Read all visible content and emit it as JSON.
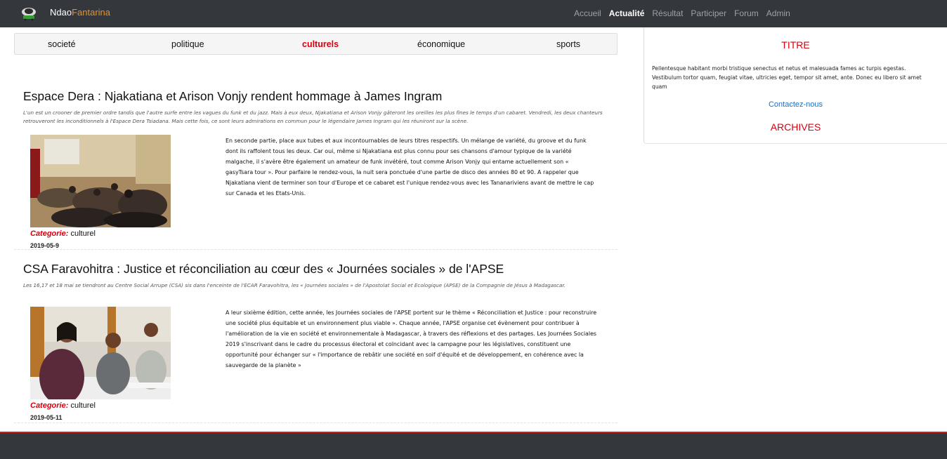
{
  "header": {
    "brand_main": "Ndao",
    "brand_accent": "Fantarina",
    "nav": [
      {
        "label": "Accueil",
        "active": false
      },
      {
        "label": "Actualité",
        "active": true
      },
      {
        "label": "Résultat",
        "active": false
      },
      {
        "label": "Participer",
        "active": false
      },
      {
        "label": "Forum",
        "active": false
      },
      {
        "label": "Admin",
        "active": false
      }
    ]
  },
  "categories": [
    {
      "label": "societé",
      "active": false
    },
    {
      "label": "politique",
      "active": false
    },
    {
      "label": "culturels",
      "active": true
    },
    {
      "label": "économique",
      "active": false
    },
    {
      "label": "sports",
      "active": false
    }
  ],
  "sidebar": {
    "title": "TITRE",
    "text": "Pellentesque habitant morbi tristique senectus et netus et malesuada fames ac turpis egestas. Vestibulum tortor quam, feugiat vitae, ultricies eget, tempor sit amet, ante. Donec eu libero sit amet quam",
    "contact_link": "Contactez-nous",
    "archives_title": "ARCHIVES"
  },
  "articles": [
    {
      "title": "Espace Dera : Njakatiana et Arison Vonjy rendent hommage à James Ingram",
      "lead": "L'un est un crooner de premier ordre tandis que l'autre surfe entre les vagues du funk et du jazz. Mais à eux deux, Njakatiana et Arison Vonjy gâteront les oreilles les plus fines le temps d'un cabaret. Vendredi, les deux chanteurs retrouveront les inconditionnels à l'Espace Dera Tsiadana. Mais cette fois, ce sont leurs admirations en commun pour le légendaire James Ingram qui les réuniront sur la scène.",
      "body": "En seconde partie, place aux tubes et aux incontournables de leurs titres respectifs. Un mélange de variété, du groove et du funk dont ils raffolent tous les deux. Car oui, même si Njakatiana est plus connu pour ses chansons d'amour typique de la variété malgache, il s'avère être également un amateur de funk invétéré, tout comme Arison Vonjy qui entame actuellement son « gasyTsara tour ». Pour parfaire le rendez-vous, la nuit sera ponctuée d'une partie de disco des années 80 et 90. A rappeler que Njakatiana vient de terminer son tour d'Europe et ce cabaret est l'unique rendez-vous avec les Tananariviens avant de mettre le cap sur Canada et les Etats-Unis.",
      "category_label": "Categorie:",
      "category": "culturel",
      "date": "2019-05-9"
    },
    {
      "title": "CSA Faravohitra : Justice et réconciliation au cœur des « Journées sociales » de l'APSE",
      "lead": "Les 16,17 et 18 mai se tiendront au Centre Social Arrupe (CSA) sis dans l'enceinte de l'ECAR Faravohitra, les « Journées sociales » de l'Apostolat Social et Ecologique (APSE) de la Compagnie de Jésus à Madagascar.",
      "body": "A leur sixième édition, cette année, les Journées sociales de l'APSE portent sur le thème « Réconciliation et Justice : pour reconstruire une société plus équitable et un environnement plus viable ». Chaque année, l'APSE organise cet évènement pour contribuer à l'amélioration de la vie en société et environnementale à Madagascar, à travers des réflexions et des partages. Les Journées Sociales 2019 s'inscrivant dans le cadre du processus électoral et coïncidant avec la campagne pour les législatives, constituent une opportunité pour échanger sur « l'importance de rebâtir une société en soif d'équité et de développement, en cohérence avec la sauvegarde de la planète »",
      "category_label": "Categorie:",
      "category": "culturel",
      "date": "2019-05-11"
    }
  ]
}
